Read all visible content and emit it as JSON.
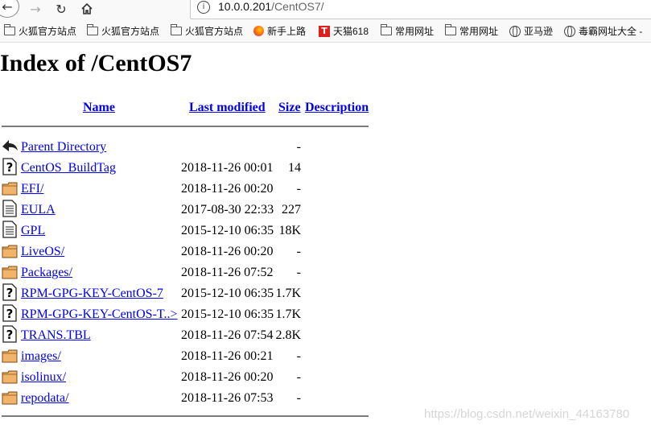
{
  "browser": {
    "url_host": "10.0.0.201",
    "url_path": "/CentOS7/",
    "bookmarks": [
      {
        "label": "火狐官方站点",
        "icon": "folder-icon"
      },
      {
        "label": "火狐官方站点",
        "icon": "folder-icon"
      },
      {
        "label": "火狐官方站点",
        "icon": "folder-icon"
      },
      {
        "label": "新手上路",
        "icon": "firefox-icon"
      },
      {
        "label": "天猫618",
        "icon": "tmall-icon"
      },
      {
        "label": "常用网址",
        "icon": "folder-icon"
      },
      {
        "label": "常用网址",
        "icon": "folder-icon"
      },
      {
        "label": "亚马逊",
        "icon": "globe-icon"
      },
      {
        "label": "毒霸网址大全 -",
        "icon": "globe-icon"
      }
    ]
  },
  "page": {
    "title": "Index of /CentOS7",
    "headers": {
      "name": "Name",
      "last_modified": "Last modified",
      "size": "Size",
      "description": "Description"
    },
    "rows": [
      {
        "icon": "back-icon",
        "name": "Parent Directory",
        "date": "",
        "size": "-"
      },
      {
        "icon": "unknown-file-icon",
        "name": "CentOS_BuildTag",
        "date": "2018-11-26 00:01",
        "size": "14"
      },
      {
        "icon": "folder-icon",
        "name": "EFI/",
        "date": "2018-11-26 00:20",
        "size": "-"
      },
      {
        "icon": "text-file-icon",
        "name": "EULA",
        "date": "2017-08-30 22:33",
        "size": "227"
      },
      {
        "icon": "text-file-icon",
        "name": "GPL",
        "date": "2015-12-10 06:35",
        "size": "18K"
      },
      {
        "icon": "folder-icon",
        "name": "LiveOS/",
        "date": "2018-11-26 00:20",
        "size": "-"
      },
      {
        "icon": "folder-icon",
        "name": "Packages/",
        "date": "2018-11-26 07:52",
        "size": "-"
      },
      {
        "icon": "unknown-file-icon",
        "name": "RPM-GPG-KEY-CentOS-7",
        "date": "2015-12-10 06:35",
        "size": "1.7K"
      },
      {
        "icon": "unknown-file-icon",
        "name": "RPM-GPG-KEY-CentOS-T..>",
        "date": "2015-12-10 06:35",
        "size": "1.7K"
      },
      {
        "icon": "unknown-file-icon",
        "name": "TRANS.TBL",
        "date": "2018-11-26 07:54",
        "size": "2.8K"
      },
      {
        "icon": "folder-icon",
        "name": "images/",
        "date": "2018-11-26 00:21",
        "size": "-"
      },
      {
        "icon": "folder-icon",
        "name": "isolinux/",
        "date": "2018-11-26 00:20",
        "size": "-"
      },
      {
        "icon": "folder-icon",
        "name": "repodata/",
        "date": "2018-11-26 07:53",
        "size": "-"
      }
    ]
  },
  "watermark": "https://blog.csdn.net/weixin_44163780"
}
